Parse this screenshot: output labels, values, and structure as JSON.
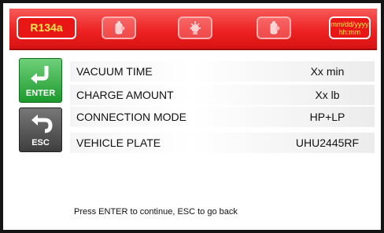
{
  "header": {
    "refrigerant": "R134a",
    "icons": [
      "refrigerant-bottle-icon",
      "oil-injector-icon",
      "refrigerant-bottle-icon"
    ],
    "date_format": "mm/dd/yyyy",
    "time_format": "hh:mm"
  },
  "sidebar": {
    "enter_label": "ENTER",
    "esc_label": "ESC"
  },
  "rows": [
    {
      "label": "VACUUM TIME",
      "value": "Xx min"
    },
    {
      "label": "CHARGE AMOUNT",
      "value": "Xx  lb"
    },
    {
      "label": "CONNECTION MODE",
      "value": "HP+LP"
    },
    {
      "label": "VEHICLE PLATE",
      "value": "UHU2445RF"
    }
  ],
  "footer": {
    "hint": "Press ENTER to continue, ESC to go back"
  },
  "colors": {
    "header_red": "#ee2222",
    "badge_text": "#ffe94d",
    "enter_green": "#1c9a2d",
    "esc_gray": "#3e3e3e"
  }
}
